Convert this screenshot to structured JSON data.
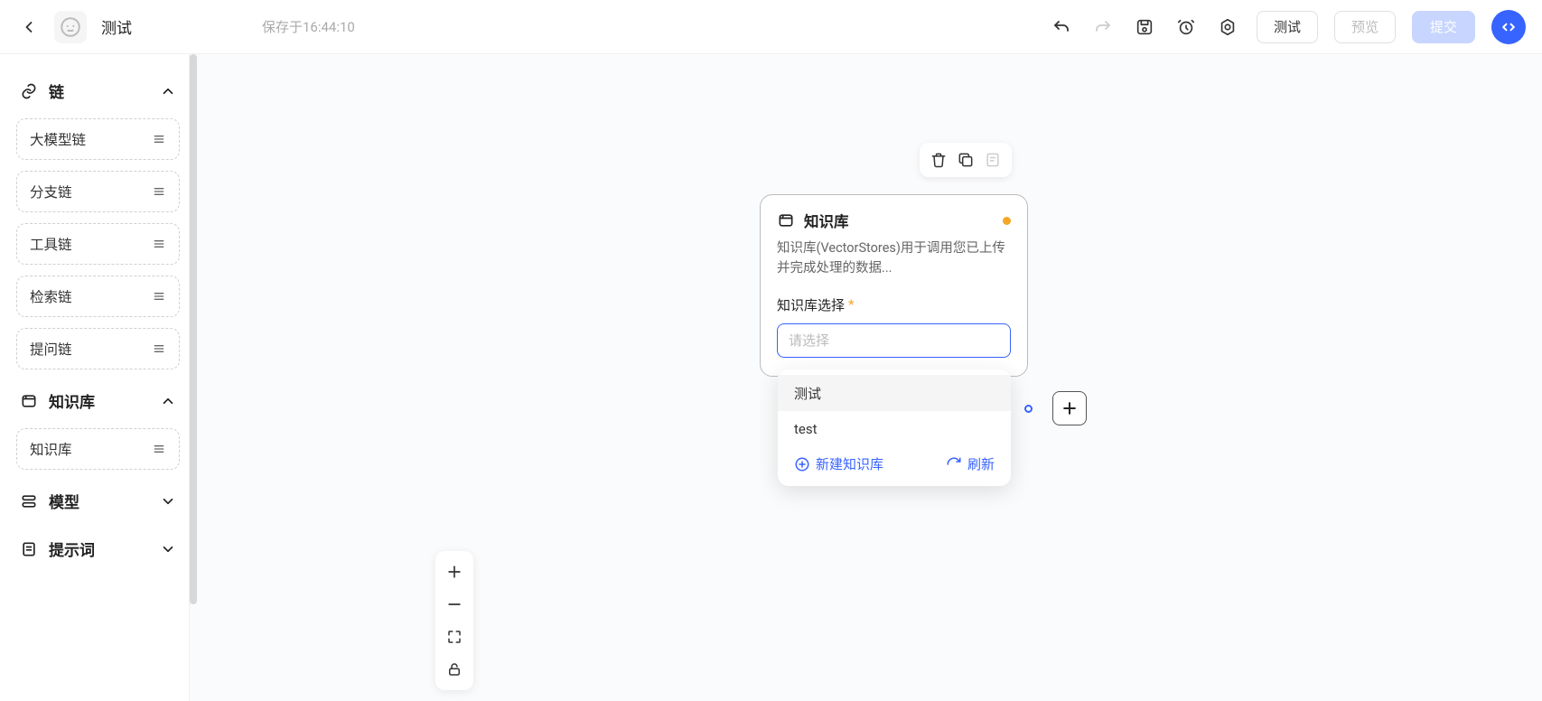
{
  "header": {
    "title": "测试",
    "saved_text": "保存于16:44:10",
    "test_btn": "测试",
    "preview_btn": "预览",
    "submit_btn": "提交"
  },
  "sidebar": {
    "groups": [
      {
        "key": "chain",
        "label": "链",
        "expanded": true,
        "items": [
          "大模型链",
          "分支链",
          "工具链",
          "检索链",
          "提问链"
        ]
      },
      {
        "key": "kb",
        "label": "知识库",
        "expanded": true,
        "items": [
          "知识库"
        ]
      },
      {
        "key": "model",
        "label": "模型",
        "expanded": false,
        "items": []
      },
      {
        "key": "prompt",
        "label": "提示词",
        "expanded": false,
        "items": []
      }
    ]
  },
  "node": {
    "title": "知识库",
    "description": "知识库(VectorStores)用于调用您已上传并完成处理的数据...",
    "field_label": "知识库选择",
    "select_placeholder": "请选择"
  },
  "dropdown": {
    "options": [
      "测试",
      "test"
    ],
    "new_label": "新建知识库",
    "refresh_label": "刷新"
  }
}
